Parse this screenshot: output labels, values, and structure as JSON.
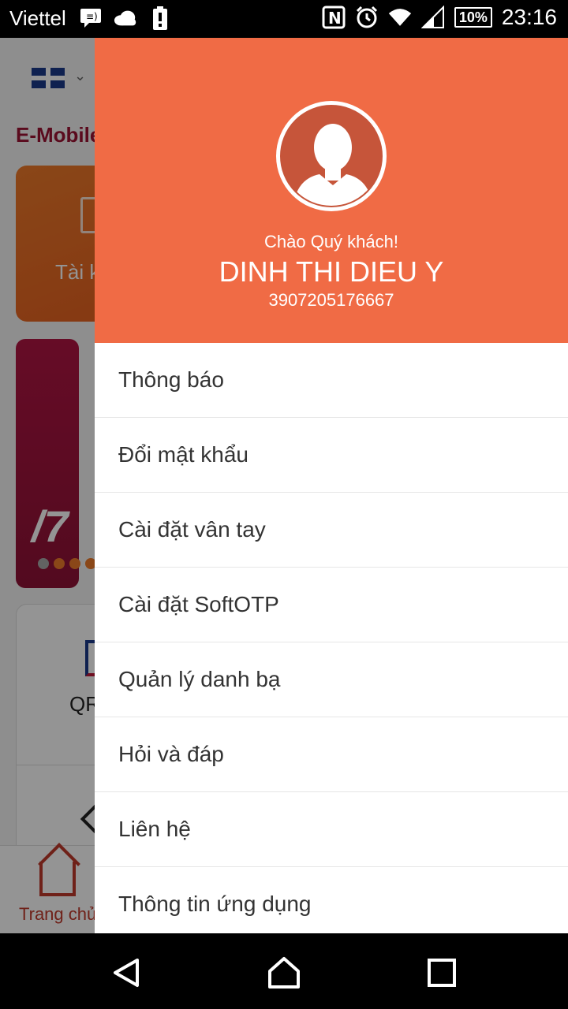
{
  "status_bar": {
    "carrier": "Viettel",
    "battery": "10%",
    "time": "23:16",
    "icons": [
      "message-icon",
      "cloud-icon",
      "battery-alert-icon",
      "nfc-icon",
      "alarm-icon",
      "wifi-icon",
      "signal-icon"
    ]
  },
  "background_app": {
    "title": "E-Mobile",
    "card_label": "Tài k",
    "banner_text": "/7",
    "qr_label": "QR",
    "bottom_nav_label": "Trang chủ"
  },
  "drawer": {
    "greeting": "Chào Quý khách!",
    "name": "DINH THI DIEU Y",
    "account_number": "3907205176667",
    "menu": [
      {
        "label": "Thông báo"
      },
      {
        "label": "Đổi mật khẩu"
      },
      {
        "label": "Cài đặt vân tay"
      },
      {
        "label": "Cài đặt SoftOTP"
      },
      {
        "label": "Quản lý danh bạ"
      },
      {
        "label": "Hỏi và đáp"
      },
      {
        "label": "Liên hệ"
      },
      {
        "label": "Thông tin ứng dụng"
      }
    ]
  },
  "colors": {
    "header": "#f06b45",
    "brand_red": "#9b1232"
  }
}
